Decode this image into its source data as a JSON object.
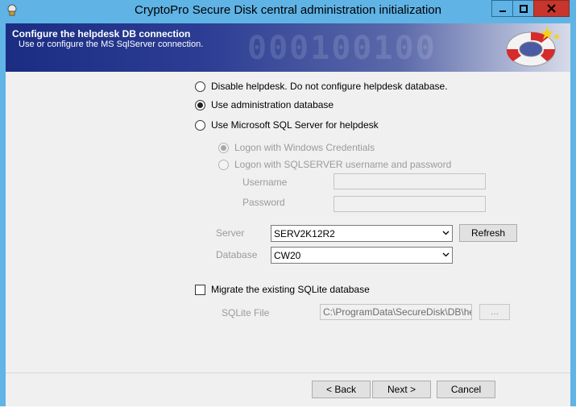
{
  "window": {
    "title": "CryptoPro Secure Disk central administration initialization"
  },
  "banner": {
    "title": "Configure the helpdesk DB connection",
    "subtitle": "Use or configure the MS SqlServer connection.",
    "digits": "000100100"
  },
  "options": {
    "disable": "Disable helpdesk. Do not configure helpdesk database.",
    "use_admin": "Use administration database",
    "use_mssql": "Use Microsoft SQL Server for helpdesk",
    "selected": "use_admin"
  },
  "logon": {
    "windows": "Logon with Windows Credentials",
    "sqlserver": "Logon with SQLSERVER username and password",
    "username_label": "Username",
    "username_value": "",
    "password_label": "Password",
    "password_value": ""
  },
  "connection": {
    "server_label": "Server",
    "server_value": "SERV2K12R2",
    "refresh_label": "Refresh",
    "database_label": "Database",
    "database_value": "CW20"
  },
  "migrate": {
    "label": "Migrate the existing SQLite database",
    "checked": false,
    "sqlite_file_label": "SQLite File",
    "sqlite_file_value": "C:\\ProgramData\\SecureDisk\\DB\\helpd",
    "browse_label": "..."
  },
  "footer": {
    "back_label": "< Back",
    "next_label": "Next >",
    "cancel_label": "Cancel"
  },
  "colors": {
    "titlebar": "#5fb3e5",
    "close_button": "#c7352c",
    "banner_dark": "#1b2d83"
  }
}
